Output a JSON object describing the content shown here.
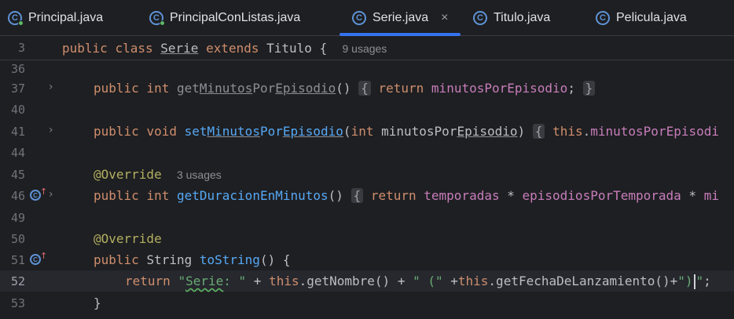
{
  "tabs": [
    {
      "label": "Principal.java",
      "active": false,
      "icon": "java-class-icon"
    },
    {
      "label": "PrincipalConListas.java",
      "active": false,
      "icon": "java-class-icon"
    },
    {
      "label": "Serie.java",
      "active": true,
      "icon": "java-class-icon",
      "close": "×"
    },
    {
      "label": "Titulo.java",
      "active": false,
      "icon": "java-class-icon"
    },
    {
      "label": "Pelicula.java",
      "active": false,
      "icon": "java-class-icon"
    }
  ],
  "icon_letter": "C",
  "sticky": {
    "line_number": "3",
    "kw_public": "public",
    "kw_class": "class",
    "class_name": "Serie",
    "kw_extends": "extends",
    "parent": "Titulo",
    "brace": "{",
    "usages": "9 usages"
  },
  "lines": [
    {
      "n": "36"
    },
    {
      "n": "37"
    },
    {
      "n": "40"
    },
    {
      "n": "41"
    },
    {
      "n": "44"
    },
    {
      "n": "45"
    },
    {
      "n": "46"
    },
    {
      "n": "49"
    },
    {
      "n": "50"
    },
    {
      "n": "51"
    },
    {
      "n": "52"
    },
    {
      "n": "53"
    }
  ],
  "code": {
    "l37": {
      "a": "public",
      "b": "int",
      "c": "get",
      "d": "Minutos",
      "e": "Por",
      "f": "Episodio",
      "g": "()",
      "fold_open": "{",
      "ret": "return",
      "field": "minutosPorEpisodio",
      "semi": ";",
      "fold_close": "}"
    },
    "l41": {
      "a": "public",
      "b": "void",
      "c": "set",
      "d": "Minutos",
      "e": "Por",
      "f": "Episodio",
      "p1": "(",
      "ptype": "int",
      "pname1": "minutosPor",
      "pname2": "Episodio",
      "p2": ")",
      "fold_open": "{",
      "this": "this",
      "dot": ".",
      "field": "minutosPorEpisodi"
    },
    "l45": {
      "ann": "@Override",
      "usages": "3 usages"
    },
    "l46": {
      "a": "public",
      "b": "int",
      "fn": "getDuracionEnMinutos",
      "g": "()",
      "fold_open": "{",
      "ret": "return",
      "f1": "temporadas",
      "op1": " * ",
      "f2": "episodiosPorTemporada",
      "op2": " * ",
      "f3": "mi"
    },
    "l50": {
      "ann": "@Override"
    },
    "l51": {
      "a": "public",
      "type": "String",
      "fn": "toString",
      "rest": "() {"
    },
    "l52": {
      "ret": "return",
      "s1a": "\"",
      "s1b": "Serie",
      "s1c": ": \"",
      "p1": " + ",
      "this1": "this",
      "call1": ".getNombre() + ",
      "s2": "\" (\"",
      "p2": " +",
      "this2": "this",
      "call2": ".getFechaDeLanzamiento()+",
      "s3a": "\")",
      "s3b": "\"",
      "end": ";"
    },
    "l53": {
      "brace": "}"
    }
  }
}
